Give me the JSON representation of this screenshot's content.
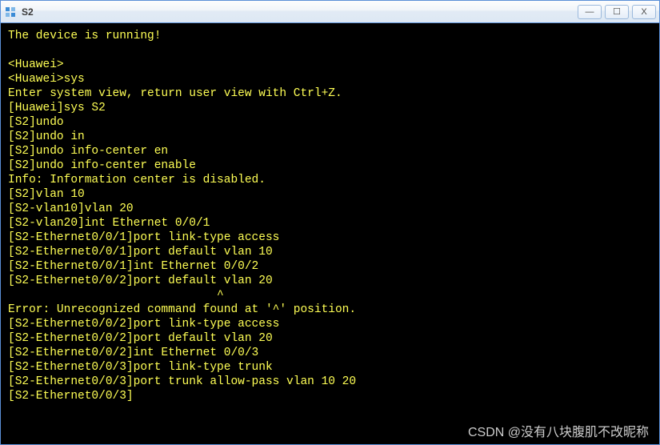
{
  "window": {
    "title": "S2",
    "icon_name": "app-icon"
  },
  "controls": {
    "minimize_glyph": "—",
    "maximize_glyph": "☐",
    "close_glyph": "X"
  },
  "terminal": {
    "lines": [
      "The device is running!",
      "",
      "<Huawei>",
      "<Huawei>sys",
      "Enter system view, return user view with Ctrl+Z.",
      "[Huawei]sys S2",
      "[S2]undo",
      "[S2]undo in",
      "[S2]undo info-center en",
      "[S2]undo info-center enable",
      "Info: Information center is disabled.",
      "[S2]vlan 10",
      "[S2-vlan10]vlan 20",
      "[S2-vlan20]int Ethernet 0/0/1",
      "[S2-Ethernet0/0/1]port link-type access",
      "[S2-Ethernet0/0/1]port default vlan 10",
      "[S2-Ethernet0/0/1]int Ethernet 0/0/2",
      "[S2-Ethernet0/0/2]port default vlan 20",
      "                              ^",
      "Error: Unrecognized command found at '^' position.",
      "[S2-Ethernet0/0/2]port link-type access",
      "[S2-Ethernet0/0/2]port default vlan 20",
      "[S2-Ethernet0/0/2]int Ethernet 0/0/3",
      "[S2-Ethernet0/0/3]port link-type trunk",
      "[S2-Ethernet0/0/3]port trunk allow-pass vlan 10 20",
      "[S2-Ethernet0/0/3]"
    ]
  },
  "watermark": "CSDN @没有八块腹肌不改昵称"
}
